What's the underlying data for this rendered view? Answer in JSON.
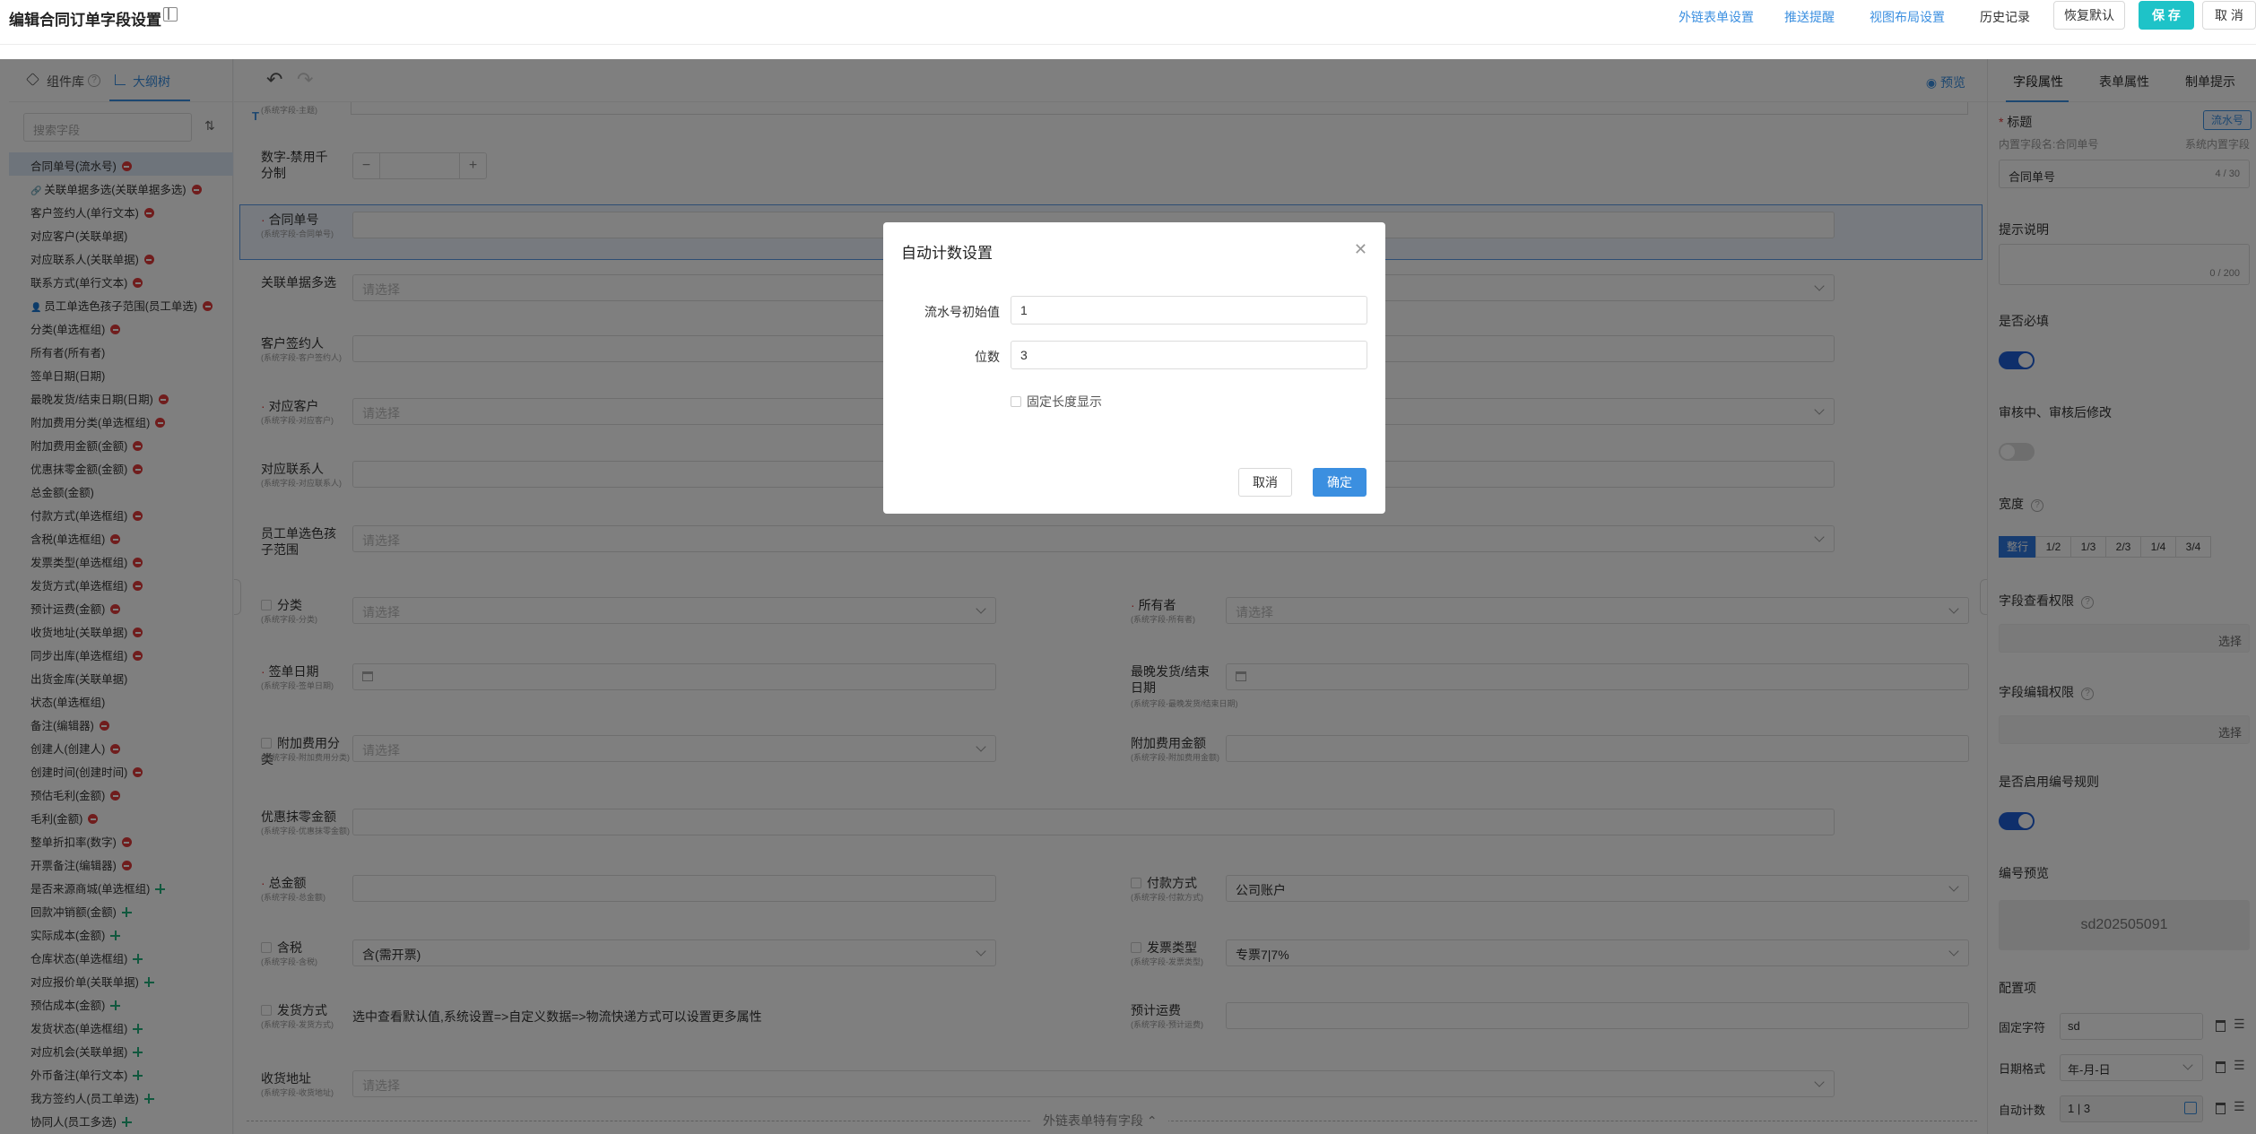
{
  "header": {
    "title": "编辑合同订单字段设置",
    "links": [
      "外链表单设置",
      "推送提醒",
      "视图布局设置"
    ],
    "history": "历史记录",
    "restore": "恢复默认",
    "save": "保 存",
    "cancel": "取 消"
  },
  "left": {
    "tab_components": "组件库",
    "tab_outline": "大纲树",
    "search_placeholder": "搜索字段",
    "items": [
      {
        "label": "合同单号(流水号)",
        "mark": "remove"
      },
      {
        "label": "关联单据多选(关联单据多选)",
        "mark": "remove"
      },
      {
        "label": "客户签约人(单行文本)",
        "mark": "remove"
      },
      {
        "label": "对应客户(关联单据)",
        "mark": "none"
      },
      {
        "label": "对应联系人(关联单据)",
        "mark": "remove"
      },
      {
        "label": "联系方式(单行文本)",
        "mark": "remove"
      },
      {
        "label": "员工单选色孩子范围(员工单选)",
        "mark": "remove"
      },
      {
        "label": "分类(单选框组)",
        "mark": "remove"
      },
      {
        "label": "所有者(所有者)",
        "mark": "none"
      },
      {
        "label": "签单日期(日期)",
        "mark": "none"
      },
      {
        "label": "最晚发货/结束日期(日期)",
        "mark": "remove"
      },
      {
        "label": "附加费用分类(单选框组)",
        "mark": "remove"
      },
      {
        "label": "附加费用金额(金额)",
        "mark": "remove"
      },
      {
        "label": "优惠抹零金额(金额)",
        "mark": "remove"
      },
      {
        "label": "总金额(金额)",
        "mark": "none"
      },
      {
        "label": "付款方式(单选框组)",
        "mark": "remove"
      },
      {
        "label": "含税(单选框组)",
        "mark": "remove"
      },
      {
        "label": "发票类型(单选框组)",
        "mark": "remove"
      },
      {
        "label": "发货方式(单选框组)",
        "mark": "remove"
      },
      {
        "label": "预计运费(金额)",
        "mark": "remove"
      },
      {
        "label": "收货地址(关联单据)",
        "mark": "remove"
      },
      {
        "label": "同步出库(单选框组)",
        "mark": "remove"
      },
      {
        "label": "出货金库(关联单据)",
        "mark": "none"
      },
      {
        "label": "状态(单选框组)",
        "mark": "none"
      },
      {
        "label": "备注(编辑器)",
        "mark": "remove"
      },
      {
        "label": "创建人(创建人)",
        "mark": "remove"
      },
      {
        "label": "创建时间(创建时间)",
        "mark": "remove"
      },
      {
        "label": "预估毛利(金额)",
        "mark": "remove"
      },
      {
        "label": "毛利(金额)",
        "mark": "remove"
      },
      {
        "label": "整单折扣率(数字)",
        "mark": "remove"
      },
      {
        "label": "开票备注(编辑器)",
        "mark": "remove"
      },
      {
        "label": "是否来源商城(单选框组)",
        "mark": "add"
      },
      {
        "label": "回款冲销额(金额)",
        "mark": "add"
      },
      {
        "label": "实际成本(金额)",
        "mark": "add"
      },
      {
        "label": "仓库状态(单选框组)",
        "mark": "add"
      },
      {
        "label": "对应报价单(关联单据)",
        "mark": "add"
      },
      {
        "label": "预估成本(金额)",
        "mark": "add"
      },
      {
        "label": "发货状态(单选框组)",
        "mark": "add"
      },
      {
        "label": "对应机会(关联单据)",
        "mark": "add"
      },
      {
        "label": "外币备注(单行文本)",
        "mark": "add"
      },
      {
        "label": "我方签约人(员工单选)",
        "mark": "add"
      },
      {
        "label": "协同人(员工多选)",
        "mark": "add"
      }
    ]
  },
  "center": {
    "preview": "预览",
    "top_sub": "(系统字段-主题)",
    "number_field": {
      "label": "数字-禁用千分制",
      "minus": "−",
      "plus": "+"
    },
    "placeholder_select": "请选择",
    "fields": [
      {
        "label": "合同单号",
        "sub": "(系统字段-合同单号)",
        "required": true
      },
      {
        "label": "关联单据多选",
        "sub": ""
      },
      {
        "label": "客户签约人",
        "sub": "(系统字段-客户签约人)"
      },
      {
        "label": "对应客户",
        "sub": "(系统字段-对应客户)",
        "required": true
      },
      {
        "label": "对应联系人",
        "sub": "(系统字段-对应联系人)"
      },
      {
        "label": "员工单选色孩子范围",
        "sub": ""
      },
      {
        "label": "分类",
        "sub": "(系统字段-分类)"
      },
      {
        "label": "所有者",
        "sub": "(系统字段-所有者)",
        "required": true
      },
      {
        "label": "签单日期",
        "sub": "(系统字段-签单日期)",
        "required": true
      },
      {
        "label": "最晚发货/结束日期",
        "sub": "(系统字段-最晚发货/结束日期)"
      },
      {
        "label": "附加费用分类",
        "sub": "(系统字段-附加费用分类)"
      },
      {
        "label": "附加费用金额",
        "sub": "(系统字段-附加费用金额)"
      },
      {
        "label": "优惠抹零金额",
        "sub": "(系统字段-优惠抹零金额)"
      },
      {
        "label": "总金额",
        "sub": "(系统字段-总金额)",
        "required": true
      },
      {
        "label": "付款方式",
        "sub": "(系统字段-付款方式)"
      },
      {
        "label": "含税",
        "sub": "(系统字段-含税)"
      },
      {
        "label": "发票类型",
        "sub": "(系统字段-发票类型)"
      },
      {
        "label": "发货方式",
        "sub": "(系统字段-发货方式)"
      },
      {
        "label": "预计运费",
        "sub": "(系统字段-预计运费)"
      },
      {
        "label": "收货地址",
        "sub": "(系统字段-收货地址)"
      }
    ],
    "values": {
      "payment": "公司账户",
      "tax": "含(需开票)",
      "invoice": "专票7|7%",
      "shipping_hint": "选中查看默认值,系统设置=>自定义数据=>物流快递方式可以设置更多属性"
    },
    "footer": "外链表单特有字段"
  },
  "right": {
    "tabs": [
      "字段属性",
      "表单属性",
      "制单提示"
    ],
    "title_label": "标题",
    "serial_badge": "流水号",
    "internal_name": "内置字段名:合同单号",
    "system_field": "系统内置字段",
    "title_value": "合同单号",
    "title_count": "4 / 30",
    "hint_label": "提示说明",
    "hint_count": "0 / 200",
    "required_label": "是否必填",
    "review_label": "审核中、审核后修改",
    "width_label": "宽度",
    "width_options": [
      "整行",
      "1/2",
      "1/3",
      "2/3",
      "1/4",
      "3/4"
    ],
    "view_perm": "字段查看权限",
    "edit_perm": "字段编辑权限",
    "select": "选择",
    "numbering_label": "是否启用编号规则",
    "preview_label": "编号预览",
    "preview_value": "sd202505091",
    "config_label": "配置项",
    "fixed_char": "固定字符",
    "fixed_char_value": "sd",
    "date_format": "日期格式",
    "date_format_value": "年-月-日",
    "auto_count": "自动计数",
    "auto_count_value": "1 | 3"
  },
  "modal": {
    "title": "自动计数设置",
    "start_label": "流水号初始值",
    "start_value": "1",
    "digits_label": "位数",
    "digits_value": "3",
    "fixed_len": "固定长度显示",
    "cancel": "取消",
    "ok": "确定"
  },
  "colors": {
    "accent": "#3b8fe0",
    "save": "#1ec3c8",
    "toggle_on": "#1f5fd6",
    "remove": "#e03a3a",
    "add": "#23b07c"
  }
}
